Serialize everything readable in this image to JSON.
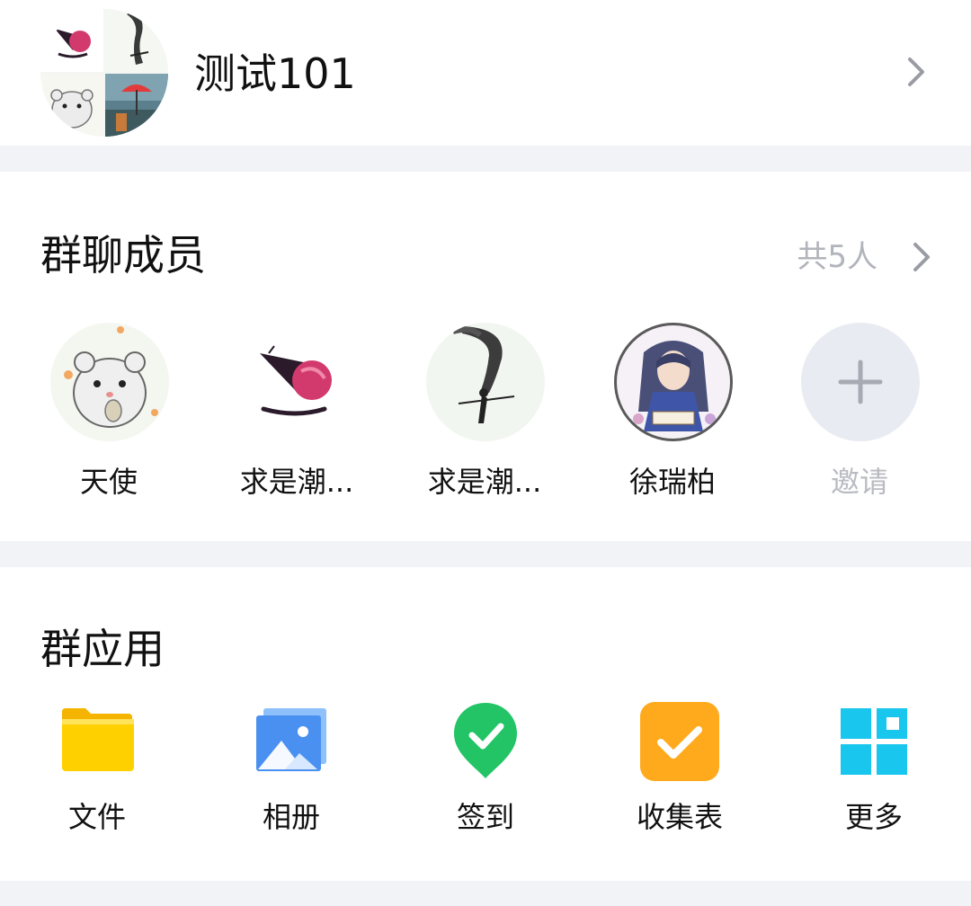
{
  "group": {
    "name": "测试101"
  },
  "members_section": {
    "title": "群聊成员",
    "count_label": "共5人",
    "members": [
      {
        "name": "天使",
        "avatar": "hamster-avatar"
      },
      {
        "name": "求是潮...",
        "avatar": "pink-logo-avatar"
      },
      {
        "name": "求是潮...",
        "avatar": "ink-swordsman-avatar"
      },
      {
        "name": "徐瑞柏",
        "avatar": "anime-character-avatar"
      }
    ],
    "invite_label": "邀请"
  },
  "apps_section": {
    "title": "群应用",
    "apps": [
      {
        "label": "文件",
        "icon": "folder-icon",
        "color": "#ffc800"
      },
      {
        "label": "相册",
        "icon": "photo-album-icon",
        "color": "#4a90f0"
      },
      {
        "label": "签到",
        "icon": "check-in-pin-icon",
        "color": "#22c466"
      },
      {
        "label": "收集表",
        "icon": "form-check-icon",
        "color": "#ffaa1c"
      },
      {
        "label": "更多",
        "icon": "more-grid-icon",
        "color": "#19c6ee"
      }
    ]
  },
  "colors": {
    "background": "#f2f3f7",
    "card": "#ffffff",
    "secondary_text": "#b2b4bb",
    "invite_circle": "#e9ebf2"
  }
}
